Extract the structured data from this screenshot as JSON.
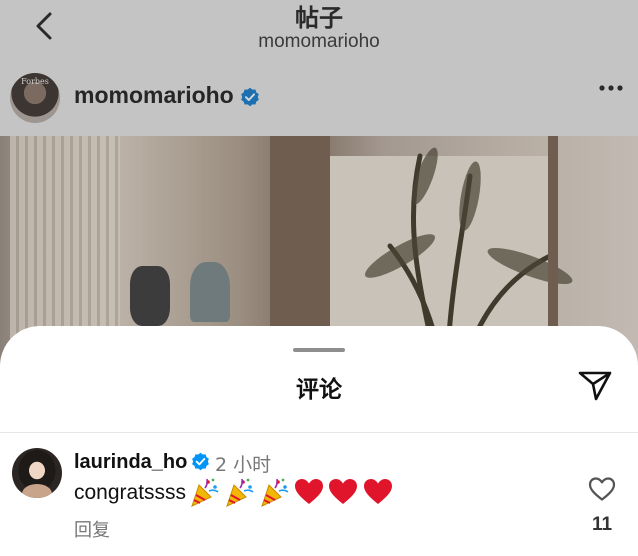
{
  "header": {
    "title": "帖子",
    "subtitle": "momomarioho"
  },
  "post": {
    "author_name": "momomarioho",
    "author_avatar_text": "Forbes",
    "verified": true
  },
  "comments_sheet": {
    "title": "评论",
    "comment": {
      "username": "laurinda_ho",
      "verified": true,
      "time": "2 小时",
      "text": "congratssss",
      "emojis": [
        "party-popper",
        "party-popper",
        "party-popper",
        "red-heart",
        "red-heart",
        "red-heart"
      ],
      "reply_label": "回复",
      "like_count": "11"
    }
  },
  "colors": {
    "verified_blue": "#0095f6",
    "heart_red": "#e0142b",
    "dim_overlay": "#c2c2c2"
  },
  "icons": {
    "back": "chevron-left-icon",
    "more": "more-dots-icon",
    "share": "paper-plane-icon",
    "like": "heart-outline-icon"
  }
}
